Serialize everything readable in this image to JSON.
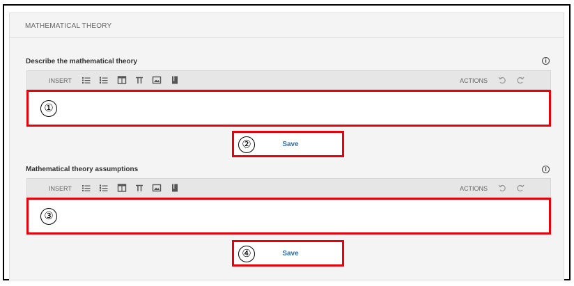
{
  "section": {
    "title": "MATHEMATICAL THEORY"
  },
  "fields": [
    {
      "label": "Describe the mathematical theory",
      "info_icon": "i",
      "toolbar": {
        "insert_label": "INSERT",
        "actions_label": "ACTIONS"
      },
      "marker": "①",
      "save_marker": "②",
      "save_label": "Save"
    },
    {
      "label": "Mathematical theory assumptions",
      "info_icon": "i",
      "toolbar": {
        "insert_label": "INSERT",
        "actions_label": "ACTIONS"
      },
      "marker": "③",
      "save_marker": "④",
      "save_label": "Save"
    }
  ],
  "toolbar_icons": [
    "bulleted-list-icon",
    "numbered-list-icon",
    "table-icon",
    "pi-icon",
    "image-icon",
    "bookmark-icon"
  ],
  "action_icons": [
    "undo-icon",
    "redo-icon"
  ],
  "colors": {
    "highlight": "#e8000b",
    "save_text": "#2a6fa8",
    "panel_bg": "#f4f4f4",
    "toolbar_bg": "#e6e6e6"
  }
}
